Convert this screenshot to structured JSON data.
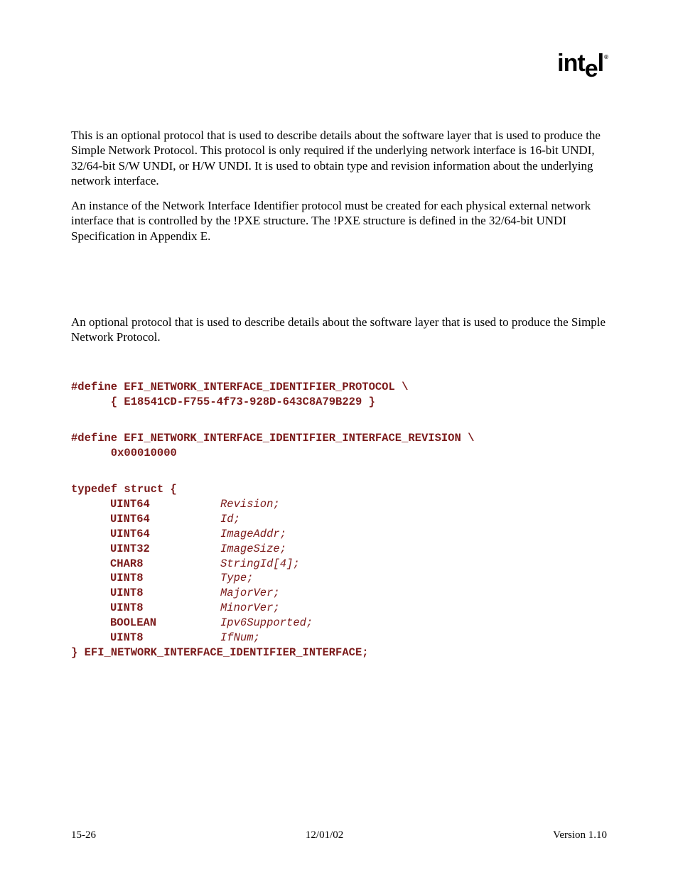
{
  "logo_text_1": "int",
  "logo_text_2": "e",
  "logo_text_3": "l",
  "logo_reg": "®",
  "para1": "This is an optional protocol that is used to describe details about the software layer that is used to produce the Simple Network Protocol.  This protocol is only required if the underlying network interface is 16-bit UNDI, 32/64-bit S/W UNDI, or H/W UNDI.  It is used to obtain type and revision information about the underlying network interface.",
  "para2": "An instance of the Network Interface Identifier protocol must be created for each physical external network interface that is controlled by the !PXE structure.  The !PXE structure is defined in the 32/64-bit UNDI Specification in Appendix E.",
  "summary": "An optional protocol that is used to describe details about the software layer that is used to produce the Simple Network Protocol.",
  "define1_line1": "#define EFI_NETWORK_INTERFACE_IDENTIFIER_PROTOCOL \\",
  "define1_line2": "      { E18541CD-F755-4f73-928D-643C8A79B229 }",
  "define2_line1": "#define EFI_NETWORK_INTERFACE_IDENTIFIER_INTERFACE_REVISION \\",
  "define2_line2": "      0x00010000",
  "struct_open": "typedef struct {",
  "fields": [
    {
      "type": "UINT64",
      "name": "Revision;"
    },
    {
      "type": "UINT64",
      "name": "Id;"
    },
    {
      "type": "UINT64",
      "name": "ImageAddr;"
    },
    {
      "type": "UINT32",
      "name": "ImageSize;"
    },
    {
      "type": "CHAR8",
      "name": "StringId[4];"
    },
    {
      "type": "UINT8",
      "name": "Type;"
    },
    {
      "type": "UINT8",
      "name": "MajorVer;"
    },
    {
      "type": "UINT8",
      "name": "MinorVer;"
    },
    {
      "type": "BOOLEAN",
      "name": "Ipv6Supported;"
    },
    {
      "type": "UINT8",
      "name": "IfNum;"
    }
  ],
  "struct_close": "} EFI_NETWORK_INTERFACE_IDENTIFIER_INTERFACE;",
  "footer": {
    "left": "15-26",
    "center": "12/01/02",
    "right": "Version 1.10"
  }
}
